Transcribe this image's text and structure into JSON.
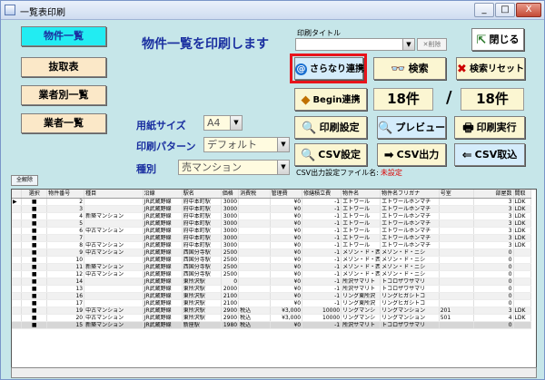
{
  "window": {
    "title": "一覧表印刷"
  },
  "titlebar": {
    "minimize": "_",
    "maximize": "□",
    "close": "X"
  },
  "nav": [
    {
      "label": "物件一覧"
    },
    {
      "label": "抜取表"
    },
    {
      "label": "業者別一覧"
    },
    {
      "label": "業者一覧"
    }
  ],
  "heading": "物件一覧を印刷します",
  "print_title": {
    "label": "印刷タイトル",
    "value": "",
    "delete_label": "削除"
  },
  "buttons": {
    "close": "閉じる",
    "sarana": "さらなり連携",
    "search": "検索",
    "search_reset": "検索リセット",
    "begin": "Begin連携",
    "print_settings": "印刷設定",
    "preview": "プレビュー",
    "print_run": "印刷実行",
    "csv_settings": "CSV設定",
    "csv_output": "CSV出力",
    "csv_import": "CSV取込",
    "select_all": "全解除"
  },
  "counts": {
    "left": "18件",
    "right": "18件"
  },
  "paper_size": {
    "label": "用紙サイズ",
    "value": "A4"
  },
  "print_pattern": {
    "label": "印刷パターン",
    "value": "デフォルト"
  },
  "category": {
    "label": "種別",
    "value": "売マンション"
  },
  "csv_file": {
    "label": "CSV出力設定ファイル名:",
    "value": "未設定"
  },
  "table": {
    "headers": [
      "",
      "選択",
      "物件番号",
      "種目",
      "沿線",
      "駅名",
      "価格",
      "消費税",
      "管理費",
      "修繕積立費",
      "物件名",
      "物件名フリガナ",
      "号室",
      "部屋数",
      "間取"
    ],
    "rows": [
      {
        "mark": "▶",
        "sel": "■",
        "no": "2",
        "type": "",
        "line": "JR武蔵野線",
        "station": "府中本町駅",
        "price": "3000",
        "tax": "",
        "mgmt": "¥0",
        "repair": "-1",
        "name": "エトワール",
        "kana": "エトワールホンマチ",
        "room": "",
        "rooms": "3",
        "layout": "LDK"
      },
      {
        "mark": "",
        "sel": "■",
        "no": "3",
        "type": "",
        "line": "JR武蔵野線",
        "station": "府中本町駅",
        "price": "3000",
        "tax": "",
        "mgmt": "¥0",
        "repair": "-1",
        "name": "エトワール",
        "kana": "エトワールホンマチ",
        "room": "",
        "rooms": "3",
        "layout": "LDK"
      },
      {
        "mark": "",
        "sel": "■",
        "no": "4",
        "type": "新築マンション",
        "line": "JR武蔵野線",
        "station": "府中本町駅",
        "price": "3000",
        "tax": "",
        "mgmt": "¥0",
        "repair": "-1",
        "name": "エトワール",
        "kana": "エトワールホンマチ",
        "room": "",
        "rooms": "3",
        "layout": "LDK"
      },
      {
        "mark": "",
        "sel": "■",
        "no": "5",
        "type": "",
        "line": "JR武蔵野線",
        "station": "府中本町駅",
        "price": "3000",
        "tax": "",
        "mgmt": "¥0",
        "repair": "-1",
        "name": "エトワール",
        "kana": "エトワールホンマチ",
        "room": "",
        "rooms": "3",
        "layout": "LDK"
      },
      {
        "mark": "",
        "sel": "■",
        "no": "6",
        "type": "中古マンション",
        "line": "JR武蔵野線",
        "station": "府中本町駅",
        "price": "3000",
        "tax": "",
        "mgmt": "¥0",
        "repair": "-1",
        "name": "エトワール",
        "kana": "エトワールホンマチ",
        "room": "",
        "rooms": "3",
        "layout": "LDK"
      },
      {
        "mark": "",
        "sel": "■",
        "no": "7",
        "type": "",
        "line": "JR武蔵野線",
        "station": "府中本町駅",
        "price": "3000",
        "tax": "",
        "mgmt": "¥0",
        "repair": "-1",
        "name": "エトワール",
        "kana": "エトワールホンマチ",
        "room": "",
        "rooms": "3",
        "layout": "LDK"
      },
      {
        "mark": "",
        "sel": "■",
        "no": "8",
        "type": "中古マンション",
        "line": "JR武蔵野線",
        "station": "府中本町駅",
        "price": "3000",
        "tax": "",
        "mgmt": "¥0",
        "repair": "-1",
        "name": "エトワール",
        "kana": "エトワールホンマチ",
        "room": "",
        "rooms": "3",
        "layout": "LDK"
      },
      {
        "mark": "",
        "sel": "■",
        "no": "9",
        "type": "中古マンション",
        "line": "JR武蔵野線",
        "station": "西国分寺駅",
        "price": "2500",
        "tax": "",
        "mgmt": "¥0",
        "repair": "-1",
        "name": "メゾン・ド・西",
        "kana": "メゾン・ド・ニシ",
        "room": "",
        "rooms": "0",
        "layout": ""
      },
      {
        "mark": "",
        "sel": "■",
        "no": "10",
        "type": "",
        "line": "JR武蔵野線",
        "station": "西国分寺駅",
        "price": "2500",
        "tax": "",
        "mgmt": "¥0",
        "repair": "-1",
        "name": "メゾン・ド・西",
        "kana": "メゾン・ド・ニシ",
        "room": "",
        "rooms": "0",
        "layout": ""
      },
      {
        "mark": "",
        "sel": "■",
        "no": "11",
        "type": "新築マンション",
        "line": "JR武蔵野線",
        "station": "西国分寺駅",
        "price": "2500",
        "tax": "",
        "mgmt": "¥0",
        "repair": "-1",
        "name": "メゾン・ド・西",
        "kana": "メゾン・ド・ニシ",
        "room": "",
        "rooms": "0",
        "layout": ""
      },
      {
        "mark": "",
        "sel": "■",
        "no": "12",
        "type": "中古マンション",
        "line": "JR武蔵野線",
        "station": "西国分寺駅",
        "price": "2500",
        "tax": "",
        "mgmt": "¥0",
        "repair": "-1",
        "name": "メゾン・ド・西",
        "kana": "メゾン・ド・ニシ",
        "room": "",
        "rooms": "0",
        "layout": ""
      },
      {
        "mark": "",
        "sel": "■",
        "no": "14",
        "type": "",
        "line": "JR武蔵野線",
        "station": "東所沢駅",
        "price": "0",
        "tax": "",
        "mgmt": "¥0",
        "repair": "-1",
        "name": "所沢サマリト",
        "kana": "トコロザワサマリ",
        "room": "",
        "rooms": "0",
        "layout": ""
      },
      {
        "mark": "",
        "sel": "■",
        "no": "13",
        "type": "",
        "line": "JR武蔵野線",
        "station": "東所沢駅",
        "price": "2000",
        "tax": "",
        "mgmt": "¥0",
        "repair": "-1",
        "name": "所沢サマリト",
        "kana": "トコロザワサマリ",
        "room": "",
        "rooms": "0",
        "layout": ""
      },
      {
        "mark": "",
        "sel": "■",
        "no": "16",
        "type": "",
        "line": "JR武蔵野線",
        "station": "東所沢駅",
        "price": "2100",
        "tax": "",
        "mgmt": "¥0",
        "repair": "-1",
        "name": "リング東所沢",
        "kana": "リングヒガシトコ",
        "room": "",
        "rooms": "0",
        "layout": ""
      },
      {
        "mark": "",
        "sel": "■",
        "no": "17",
        "type": "",
        "line": "JR武蔵野線",
        "station": "東所沢駅",
        "price": "2100",
        "tax": "",
        "mgmt": "¥0",
        "repair": "-1",
        "name": "リング東所沢",
        "kana": "リングヒガシトコ",
        "room": "",
        "rooms": "0",
        "layout": ""
      },
      {
        "mark": "",
        "sel": "■",
        "no": "19",
        "type": "中古マンション",
        "line": "JR武蔵野線",
        "station": "東所沢駅",
        "price": "2900",
        "tax": "税込",
        "mgmt": "¥3,000",
        "repair": "10000",
        "name": "リングマンシ",
        "kana": "リングマンション",
        "room": "201",
        "rooms": "3",
        "layout": "LDK"
      },
      {
        "mark": "",
        "sel": "■",
        "no": "20",
        "type": "中古マンション",
        "line": "JR武蔵野線",
        "station": "東所沢駅",
        "price": "2900",
        "tax": "税込",
        "mgmt": "¥3,000",
        "repair": "10000",
        "name": "リングマンシ",
        "kana": "リングマンション",
        "room": "501",
        "rooms": "4",
        "layout": "LDK"
      },
      {
        "mark": "",
        "sel": "■",
        "no": "15",
        "type": "新築マンション",
        "line": "JR武蔵野線",
        "station": "新座駅",
        "price": "1980",
        "tax": "税込",
        "mgmt": "¥0",
        "repair": "-1",
        "name": "所沢サマリト",
        "kana": "トコロザワサマリ",
        "room": "",
        "rooms": "0",
        "layout": ""
      }
    ]
  }
}
